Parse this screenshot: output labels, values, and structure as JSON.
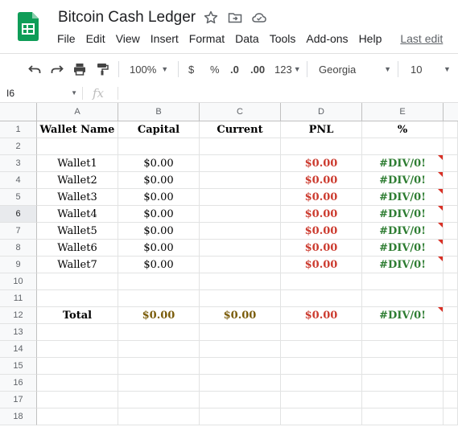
{
  "app": {
    "title": "Bitcoin Cash Ledger",
    "menu": [
      "File",
      "Edit",
      "View",
      "Insert",
      "Format",
      "Data",
      "Tools",
      "Add-ons",
      "Help"
    ],
    "last_edit": "Last edit"
  },
  "toolbar": {
    "zoom": "100%",
    "currency": "$",
    "percent": "%",
    "dec_decrease": ".0",
    "dec_increase": ".00",
    "more_formats": "123",
    "font": "Georgia",
    "font_size": "10"
  },
  "formula_bar": {
    "name_box": "I6",
    "fx": "fx",
    "value": ""
  },
  "columns": [
    "A",
    "B",
    "C",
    "D",
    "E"
  ],
  "rows": [
    "1",
    "2",
    "3",
    "4",
    "5",
    "6",
    "7",
    "8",
    "9",
    "10",
    "11",
    "12",
    "13",
    "14",
    "15",
    "16",
    "17",
    "18"
  ],
  "selected_row": "6",
  "sheet": {
    "headers": [
      "Wallet Name",
      "Capital",
      "Current",
      "PNL",
      "%"
    ],
    "wallets": [
      {
        "name": "Wallet1",
        "capital": "$0.00",
        "pnl": "$0.00",
        "pct": "#DIV/0!"
      },
      {
        "name": "Wallet2",
        "capital": "$0.00",
        "pnl": "$0.00",
        "pct": "#DIV/0!"
      },
      {
        "name": "Wallet3",
        "capital": "$0.00",
        "pnl": "$0.00",
        "pct": "#DIV/0!"
      },
      {
        "name": "Wallet4",
        "capital": "$0.00",
        "pnl": "$0.00",
        "pct": "#DIV/0!"
      },
      {
        "name": "Wallet5",
        "capital": "$0.00",
        "pnl": "$0.00",
        "pct": "#DIV/0!"
      },
      {
        "name": "Wallet6",
        "capital": "$0.00",
        "pnl": "$0.00",
        "pct": "#DIV/0!"
      },
      {
        "name": "Wallet7",
        "capital": "$0.00",
        "pnl": "$0.00",
        "pct": "#DIV/0!"
      }
    ],
    "total": {
      "label": "Total",
      "capital": "$0.00",
      "current": "$0.00",
      "pnl": "$0.00",
      "pct": "#DIV/0!"
    }
  },
  "colors": {
    "pnl": "#cc3b2f",
    "pct": "#2e7d32",
    "total": "#7a5c0a",
    "error_marker": "#d93025"
  }
}
